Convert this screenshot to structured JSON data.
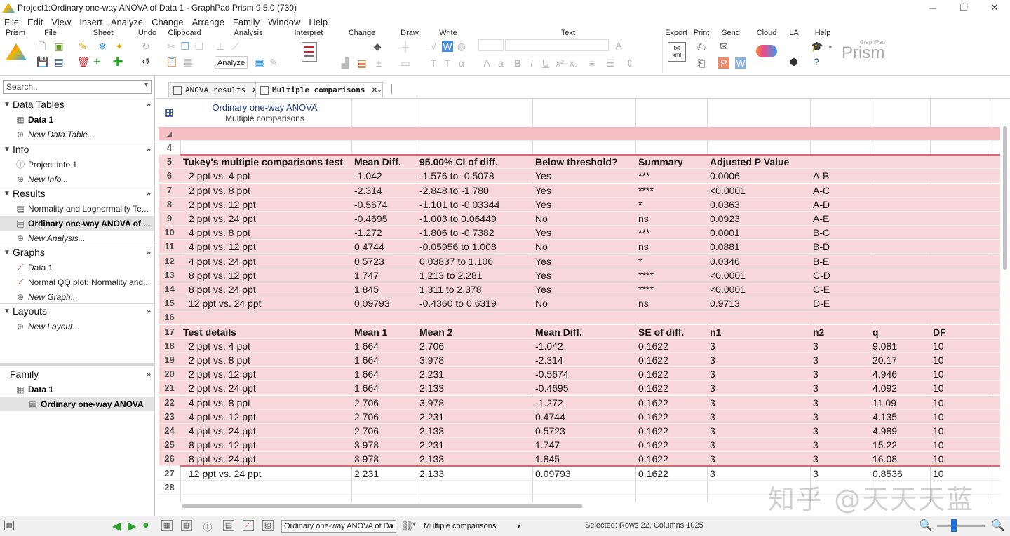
{
  "window": {
    "title": "Project1:Ordinary one-way ANOVA of Data 1 - GraphPad Prism 9.5.0 (730)"
  },
  "menu": [
    "File",
    "Edit",
    "View",
    "Insert",
    "Analyze",
    "Change",
    "Arrange",
    "Family",
    "Window",
    "Help"
  ],
  "ribbon": {
    "groups": [
      "Prism",
      "File",
      "Sheet",
      "Undo",
      "Clipboard",
      "Analysis",
      "Interpret",
      "Change",
      "Draw",
      "Write",
      "Text",
      "Export",
      "Print",
      "Send",
      "Cloud",
      "LA",
      "Help"
    ],
    "analyze_label": "Analyze",
    "brand_small": "GraphPad",
    "brand": "Prism"
  },
  "navigator": {
    "search_placeholder": "Search...",
    "sections": {
      "data_tables": {
        "label": "Data Tables",
        "items": [
          "Data 1",
          "New Data Table..."
        ]
      },
      "info": {
        "label": "Info",
        "items": [
          "Project info 1",
          "New Info..."
        ]
      },
      "results": {
        "label": "Results",
        "items": [
          "Normality and Lognormality Te...",
          "Ordinary one-way ANOVA of ...",
          "New Analysis..."
        ]
      },
      "graphs": {
        "label": "Graphs",
        "items": [
          "Data 1",
          "Normal QQ plot: Normality and...",
          "New Graph..."
        ]
      },
      "layouts": {
        "label": "Layouts",
        "items": [
          "New Layout..."
        ]
      }
    },
    "family": {
      "label": "Family",
      "items": [
        "Data 1",
        "Ordinary one-way ANOVA"
      ]
    }
  },
  "tabs": [
    {
      "label": "ANOVA results"
    },
    {
      "label": "Multiple comparisons"
    }
  ],
  "sheet": {
    "title": "Ordinary one-way ANOVA",
    "subtitle": "Multiple comparisons",
    "rows": [
      {
        "n": "4",
        "cells": []
      },
      {
        "n": "5",
        "cells": [
          "Tukey's multiple comparisons test",
          "Mean Diff.",
          "95.00% CI of diff.",
          "Below threshold?",
          "Summary",
          "Adjusted P Value",
          "",
          "",
          ""
        ],
        "bold": true
      },
      {
        "n": "6",
        "cells": [
          "2 ppt vs. 4 ppt",
          "-1.042",
          "-1.576 to -0.5078",
          "Yes",
          "***",
          "0.0006",
          "A-B",
          "",
          ""
        ]
      },
      {
        "n": "7",
        "cells": [
          "2 ppt vs. 8 ppt",
          "-2.314",
          "-2.848 to -1.780",
          "Yes",
          "****",
          "<0.0001",
          "A-C",
          "",
          ""
        ]
      },
      {
        "n": "8",
        "cells": [
          "2 ppt vs. 12 ppt",
          "-0.5674",
          "-1.101 to -0.03344",
          "Yes",
          "*",
          "0.0363",
          "A-D",
          "",
          ""
        ]
      },
      {
        "n": "9",
        "cells": [
          "2 ppt vs. 24 ppt",
          "-0.4695",
          "-1.003 to 0.06449",
          "No",
          "ns",
          "0.0923",
          "A-E",
          "",
          ""
        ]
      },
      {
        "n": "10",
        "cells": [
          "4 ppt vs. 8 ppt",
          "-1.272",
          "-1.806 to -0.7382",
          "Yes",
          "***",
          "0.0001",
          "B-C",
          "",
          ""
        ]
      },
      {
        "n": "11",
        "cells": [
          "4 ppt vs. 12 ppt",
          "0.4744",
          "-0.05956 to 1.008",
          "No",
          "ns",
          "0.0881",
          "B-D",
          "",
          ""
        ]
      },
      {
        "n": "12",
        "cells": [
          "4 ppt vs. 24 ppt",
          "0.5723",
          "0.03837 to 1.106",
          "Yes",
          "*",
          "0.0346",
          "B-E",
          "",
          ""
        ]
      },
      {
        "n": "13",
        "cells": [
          "8 ppt vs. 12 ppt",
          "1.747",
          "1.213 to 2.281",
          "Yes",
          "****",
          "<0.0001",
          "C-D",
          "",
          ""
        ]
      },
      {
        "n": "14",
        "cells": [
          "8 ppt vs. 24 ppt",
          "1.845",
          "1.311 to 2.378",
          "Yes",
          "****",
          "<0.0001",
          "C-E",
          "",
          ""
        ]
      },
      {
        "n": "15",
        "cells": [
          "12 ppt vs. 24 ppt",
          "0.09793",
          "-0.4360 to 0.6319",
          "No",
          "ns",
          "0.9713",
          "D-E",
          "",
          ""
        ]
      },
      {
        "n": "16",
        "cells": []
      },
      {
        "n": "17",
        "cells": [
          "Test details",
          "Mean 1",
          "Mean 2",
          "Mean Diff.",
          "SE of diff.",
          "n1",
          "n2",
          "q",
          "DF"
        ],
        "bold": true
      },
      {
        "n": "18",
        "cells": [
          "2 ppt vs. 4 ppt",
          "1.664",
          "2.706",
          "-1.042",
          "0.1622",
          "3",
          "3",
          "9.081",
          "10"
        ]
      },
      {
        "n": "19",
        "cells": [
          "2 ppt vs. 8 ppt",
          "1.664",
          "3.978",
          "-2.314",
          "0.1622",
          "3",
          "3",
          "20.17",
          "10"
        ]
      },
      {
        "n": "20",
        "cells": [
          "2 ppt vs. 12 ppt",
          "1.664",
          "2.231",
          "-0.5674",
          "0.1622",
          "3",
          "3",
          "4.946",
          "10"
        ]
      },
      {
        "n": "21",
        "cells": [
          "2 ppt vs. 24 ppt",
          "1.664",
          "2.133",
          "-0.4695",
          "0.1622",
          "3",
          "3",
          "4.092",
          "10"
        ]
      },
      {
        "n": "22",
        "cells": [
          "4 ppt vs. 8 ppt",
          "2.706",
          "3.978",
          "-1.272",
          "0.1622",
          "3",
          "3",
          "11.09",
          "10"
        ]
      },
      {
        "n": "23",
        "cells": [
          "4 ppt vs. 12 ppt",
          "2.706",
          "2.231",
          "0.4744",
          "0.1622",
          "3",
          "3",
          "4.135",
          "10"
        ]
      },
      {
        "n": "24",
        "cells": [
          "4 ppt vs. 24 ppt",
          "2.706",
          "2.133",
          "0.5723",
          "0.1622",
          "3",
          "3",
          "4.989",
          "10"
        ]
      },
      {
        "n": "25",
        "cells": [
          "8 ppt vs. 12 ppt",
          "3.978",
          "2.231",
          "1.747",
          "0.1622",
          "3",
          "3",
          "15.22",
          "10"
        ]
      },
      {
        "n": "26",
        "cells": [
          "8 ppt vs. 24 ppt",
          "3.978",
          "2.133",
          "1.845",
          "0.1622",
          "3",
          "3",
          "16.08",
          "10"
        ]
      },
      {
        "n": "27",
        "cells": [
          "12 ppt vs. 24 ppt",
          "2.231",
          "2.133",
          "0.09793",
          "0.1622",
          "3",
          "3",
          "0.8536",
          "10"
        ],
        "white": true
      },
      {
        "n": "28",
        "cells": [],
        "white": true
      }
    ]
  },
  "statusbar": {
    "sheet_select": "Ordinary one-way ANOVA of Da",
    "view_select": "Multiple comparisons",
    "selection": "Selected: Rows 22, Columns 1025"
  },
  "watermark": "知乎 @天天天蓝",
  "colors": {
    "selection_pink": "#f7d7d9",
    "header_pink": "#f5bfc4",
    "title_blue": "#1f3c88"
  }
}
